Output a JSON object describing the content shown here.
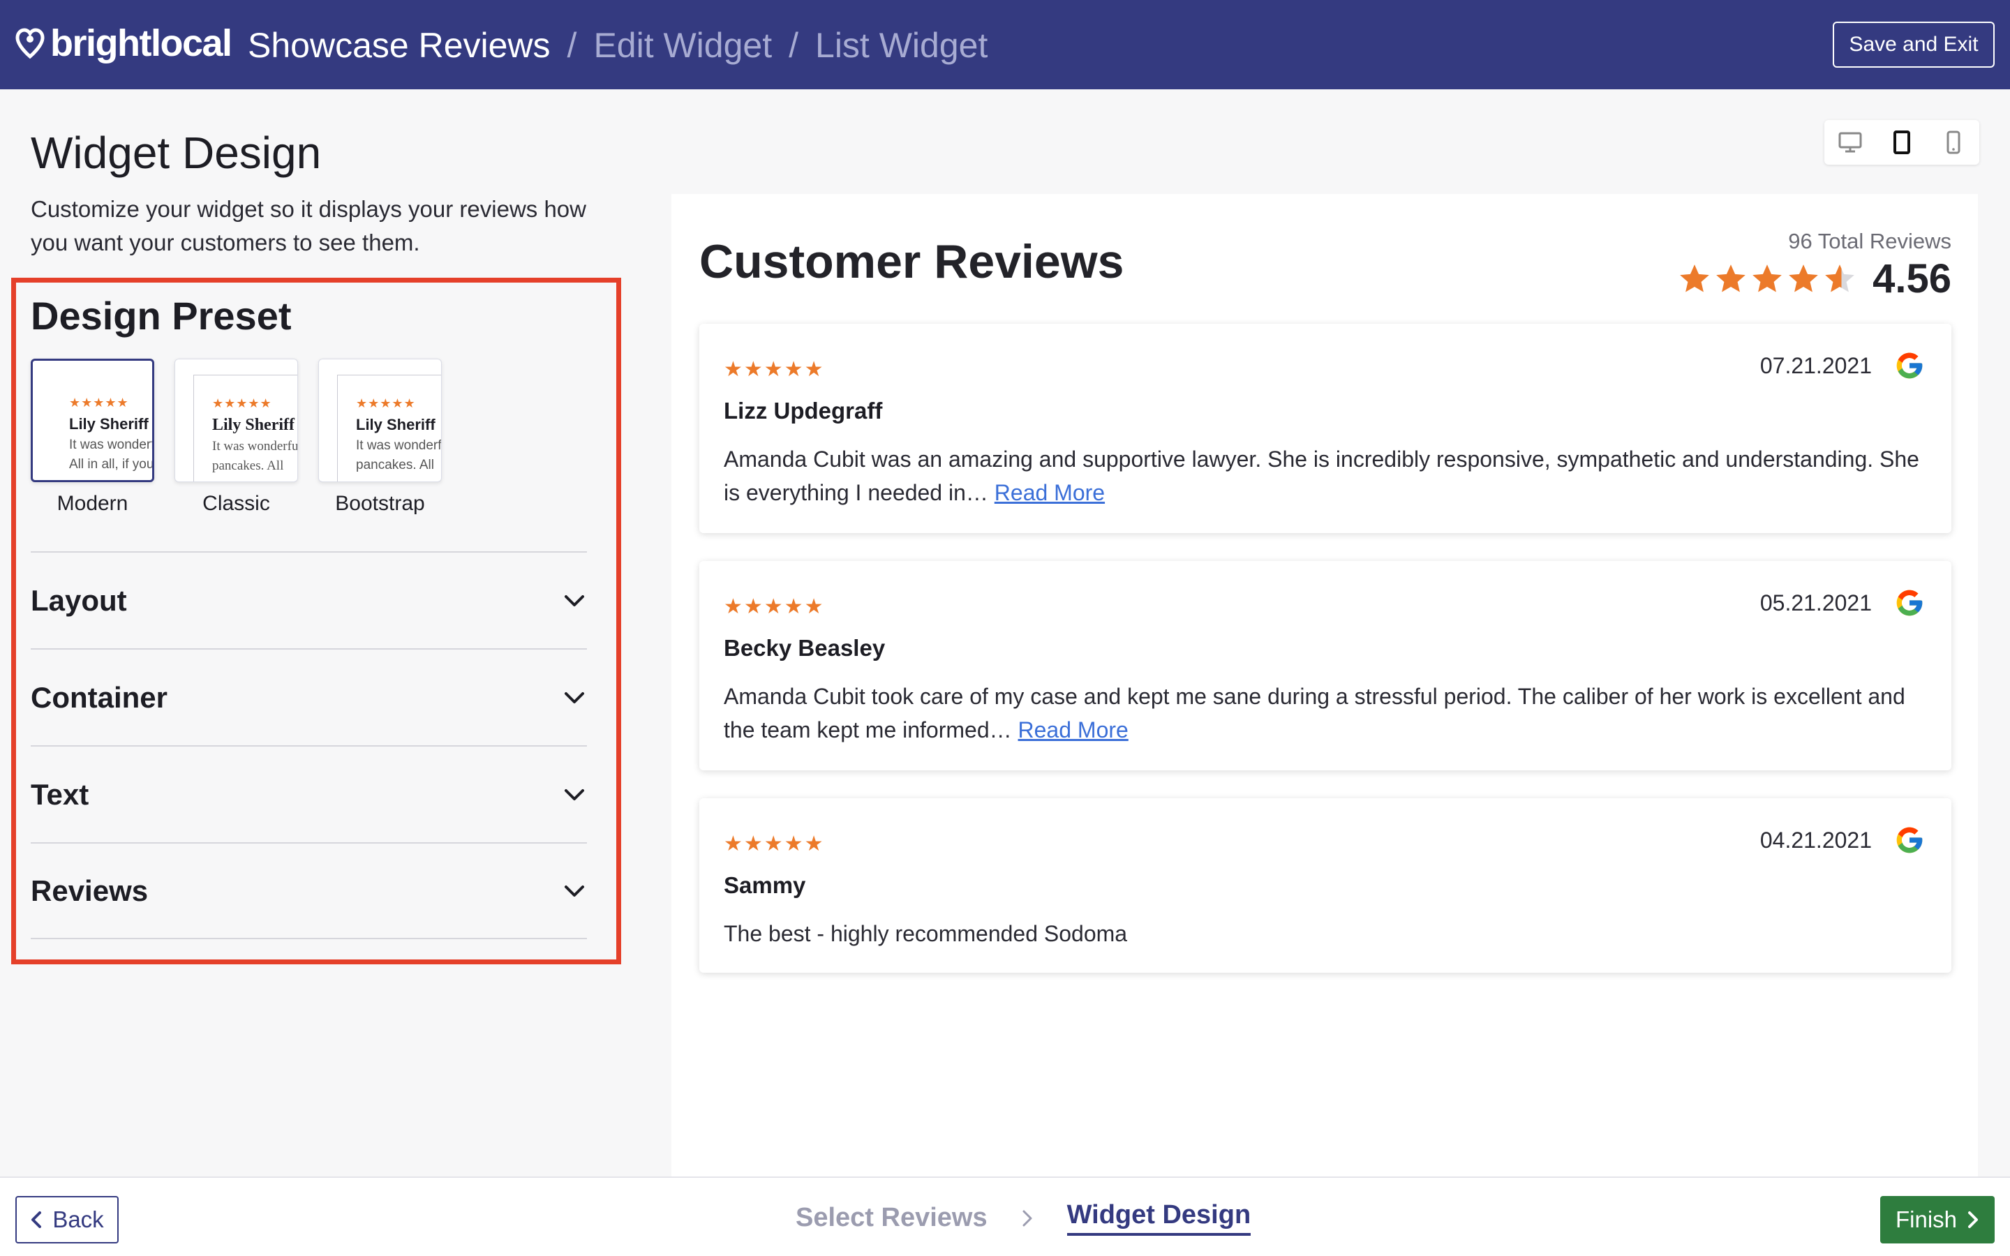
{
  "brand": {
    "name": "brightlocal"
  },
  "breadcrumbs": [
    "Showcase Reviews",
    "Edit Widget",
    "List Widget"
  ],
  "breadcrumb_separator": "/",
  "header": {
    "save_exit_label": "Save and Exit"
  },
  "panel": {
    "title": "Widget Design",
    "description": "Customize your widget so it displays your reviews how you want your customers to see them.",
    "preset_title": "Design Preset",
    "presets": [
      {
        "label": "Modern",
        "stars": "★★★★★",
        "name": "Lily Sheriff",
        "line1": "It was wonderful",
        "line2": "All in all, if you",
        "selected": true
      },
      {
        "label": "Classic",
        "stars": "★★★★★",
        "name": "Lily Sheriff",
        "line1": "It was wonderful",
        "line2": "pancakes. All",
        "selected": false
      },
      {
        "label": "Bootstrap",
        "stars": "★★★★★",
        "name": "Lily Sheriff",
        "line1": "It was wonderful",
        "line2": "pancakes. All",
        "selected": false
      }
    ],
    "sections": [
      "Layout",
      "Container",
      "Text",
      "Reviews"
    ]
  },
  "device_toggle": {
    "options": [
      "desktop",
      "tablet",
      "mobile"
    ],
    "active": "tablet"
  },
  "preview": {
    "title": "Customer Reviews",
    "total_reviews": "96 Total Reviews",
    "rating": 4.56,
    "rating_text": "4.56",
    "star_color": "#ec7a2a",
    "reviews": [
      {
        "stars": "★★★★★",
        "date": "07.21.2021",
        "source": "google",
        "author": "Lizz Updegraff",
        "text": "Amanda Cubit was an amazing and supportive lawyer. She is incredibly responsive, sympathetic and understanding. She is everything I needed in…",
        "read_more": "Read More"
      },
      {
        "stars": "★★★★★",
        "date": "05.21.2021",
        "source": "google",
        "author": "Becky Beasley",
        "text": "Amanda Cubit took care of my case and kept me sane during a stressful period. The caliber of her work is excellent and the team kept me informed…",
        "read_more": "Read More"
      },
      {
        "stars": "★★★★★",
        "date": "04.21.2021",
        "source": "google",
        "author": "Sammy",
        "text": "The best - highly recommended Sodoma",
        "read_more": ""
      }
    ]
  },
  "footer": {
    "back_label": "Back",
    "steps": [
      "Select Reviews",
      "Widget Design"
    ],
    "current_step": "Widget Design",
    "finish_label": "Finish"
  },
  "colors": {
    "header_bg": "#343a80",
    "highlight": "#e5402a",
    "finish_bg": "#2e7d3e",
    "link": "#3b6fd8"
  }
}
